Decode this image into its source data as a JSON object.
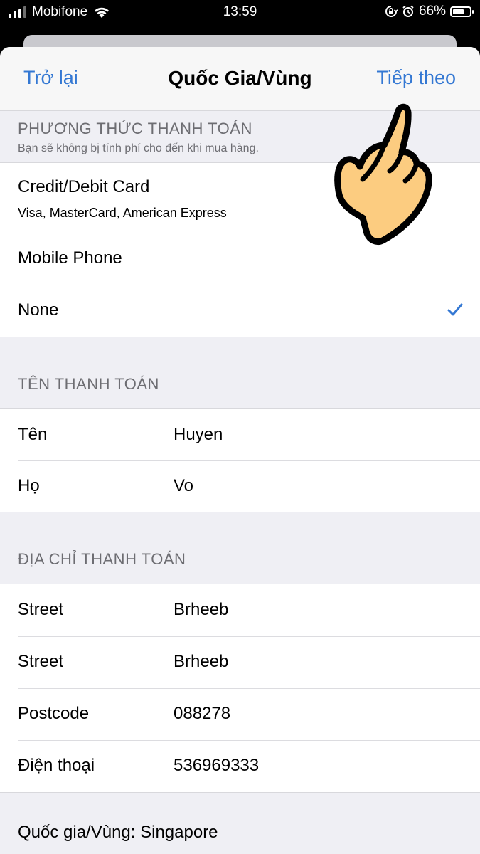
{
  "status": {
    "carrier": "Mobifone",
    "time": "13:59",
    "battery": "66%",
    "battery_level": 0.66
  },
  "nav": {
    "back": "Trở lại",
    "title": "Quốc Gia/Vùng",
    "next": "Tiếp theo"
  },
  "payment": {
    "header": "PHƯƠNG THỨC THANH TOÁN",
    "subheader": "Bạn sẽ không bị tính phí cho đến khi mua hàng.",
    "options": [
      {
        "label": "Credit/Debit Card",
        "detail": "Visa, MasterCard, American Express"
      },
      {
        "label": "Mobile Phone"
      },
      {
        "label": "None",
        "selected": true
      }
    ]
  },
  "billing_name": {
    "header": "TÊN THANH TOÁN",
    "rows": [
      {
        "label": "Tên",
        "value": "Huyen"
      },
      {
        "label": "Họ",
        "value": "Vo"
      }
    ]
  },
  "billing_address": {
    "header": "ĐỊA CHỈ THANH TOÁN",
    "rows": [
      {
        "label": "Street",
        "value": "Brheeb"
      },
      {
        "label": "Street",
        "value": "Brheeb"
      },
      {
        "label": "Postcode",
        "value": "088278"
      },
      {
        "label": "Điện thoại",
        "value": "536969333"
      }
    ]
  },
  "footer": {
    "country": "Quốc gia/Vùng: Singapore"
  },
  "colors": {
    "accent": "#3478d3",
    "background": "#efeff4",
    "header_text": "#6d6d72",
    "hand_fill": "#fccc80"
  },
  "icons": [
    "signal-icon",
    "wifi-icon",
    "orientation-lock-icon",
    "alarm-icon",
    "battery-icon",
    "checkmark-icon",
    "pointing-hand-icon"
  ]
}
